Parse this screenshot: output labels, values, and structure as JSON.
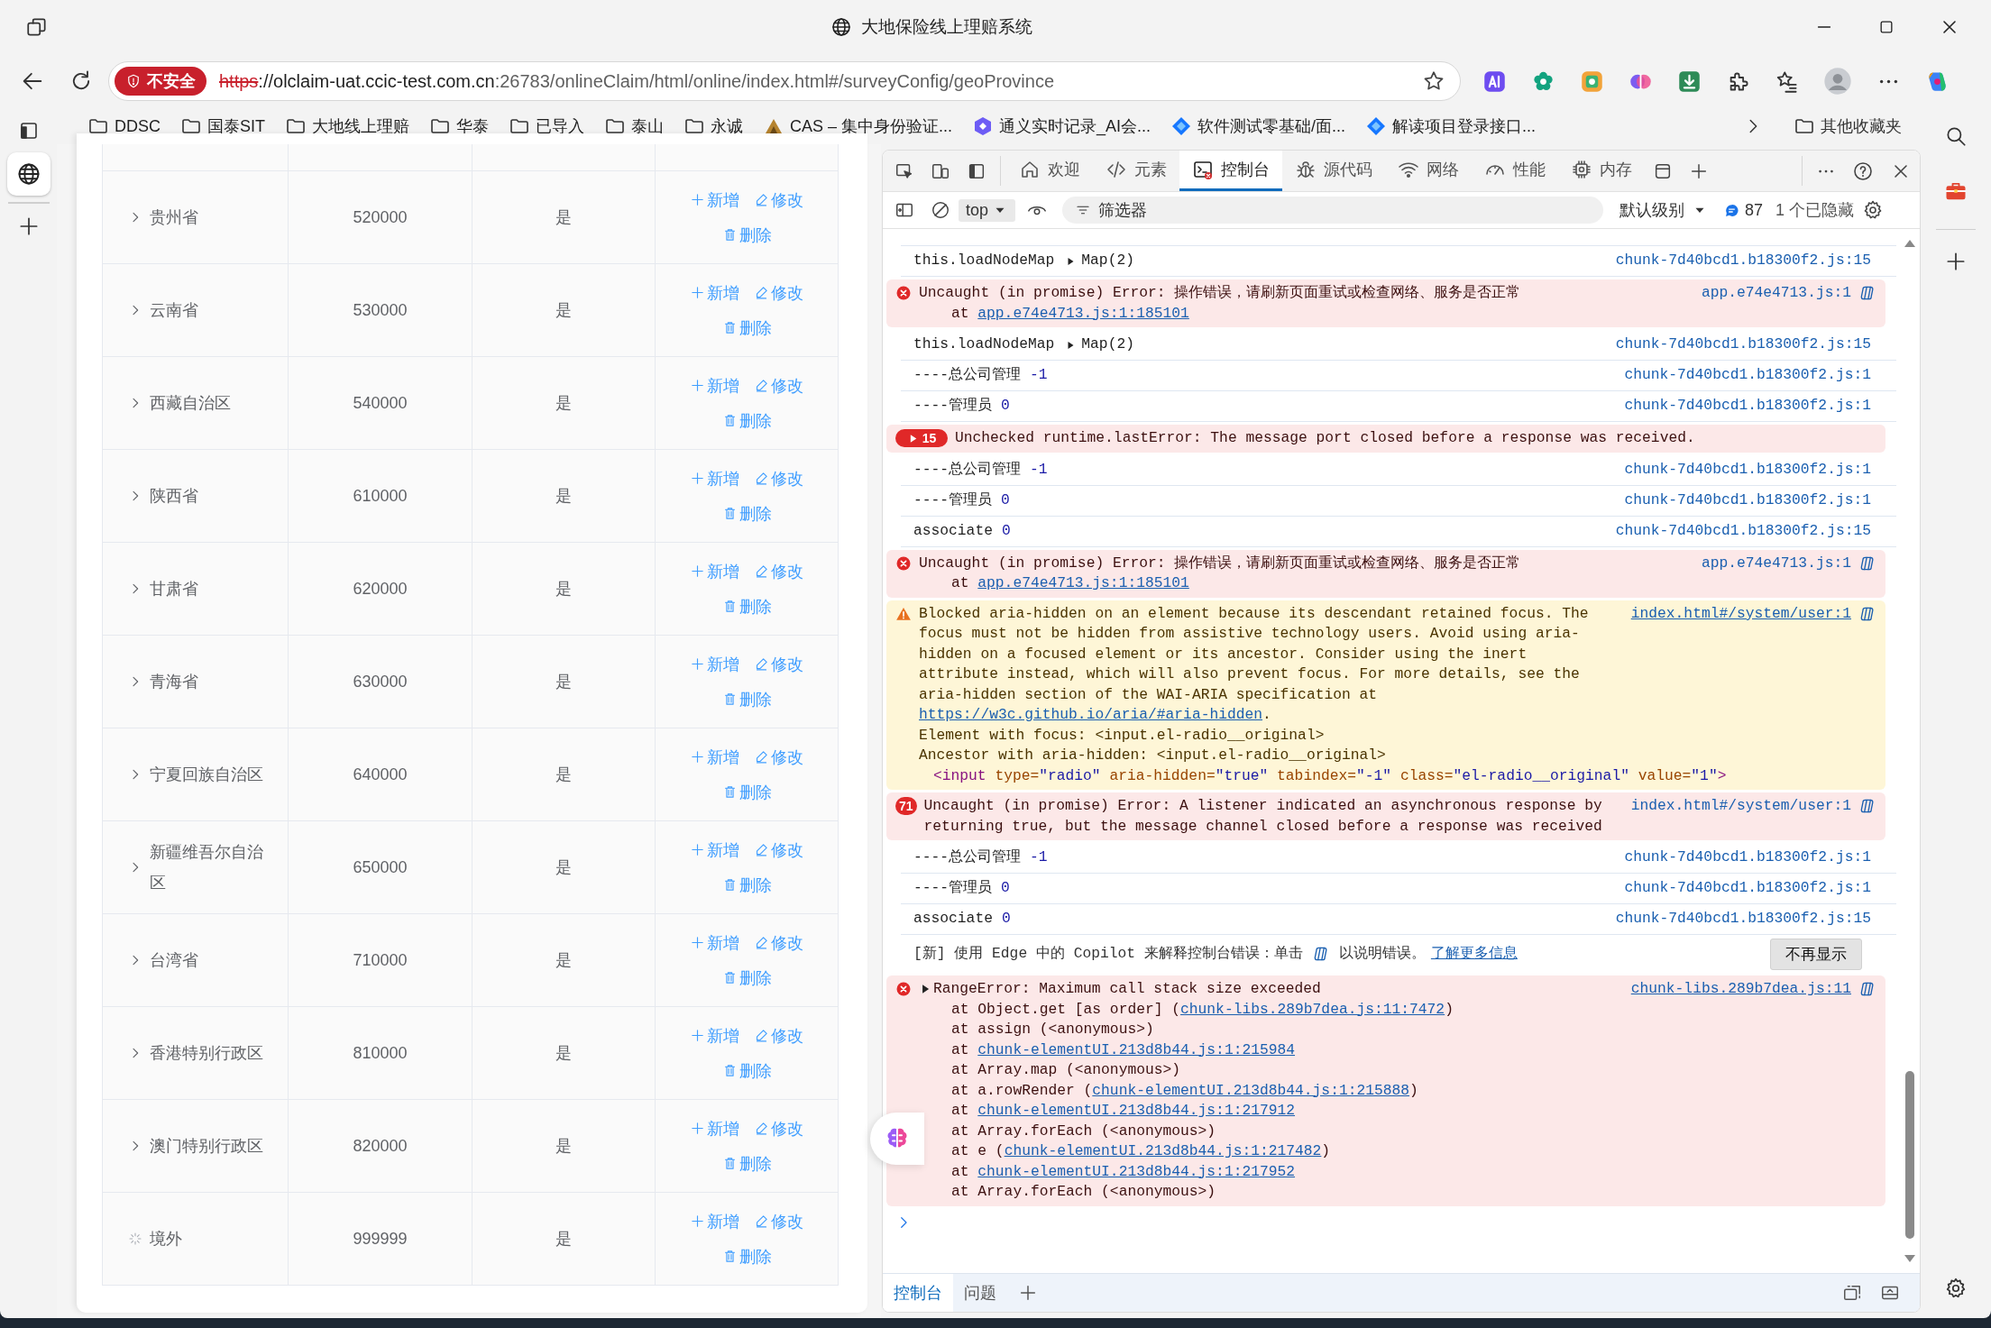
{
  "window": {
    "title": "大地保险线上理赔系统"
  },
  "address_bar": {
    "security_label": "不安全",
    "scheme": "https",
    "host": "://olclaim-uat.ccic-test.com.cn",
    "path": ":26783/onlineClaim/html/online/index.html#/surveyConfig/geoProvince"
  },
  "bookmarks": [
    {
      "kind": "folder",
      "label": "DDSC"
    },
    {
      "kind": "folder",
      "label": "国泰SIT"
    },
    {
      "kind": "folder",
      "label": "大地线上理赔"
    },
    {
      "kind": "folder",
      "label": "华泰"
    },
    {
      "kind": "folder",
      "label": "已导入"
    },
    {
      "kind": "folder",
      "label": "泰山"
    },
    {
      "kind": "folder",
      "label": "永诚"
    },
    {
      "kind": "cas",
      "label": "CAS – 集中身份验证..."
    },
    {
      "kind": "hexagon",
      "label": "通义实时记录_AI会..."
    },
    {
      "kind": "diamond",
      "label": "软件测试零基础/面..."
    },
    {
      "kind": "diamond",
      "label": "解读项目登录接口..."
    }
  ],
  "other_bookmarks": "其他收藏夹",
  "table": {
    "rows": [
      {
        "kind": "expandable",
        "name": "贵州省",
        "code": "520000",
        "flag": "是",
        "actions": [
          {
            "kind": "add",
            "label": "新增"
          },
          {
            "kind": "edit",
            "label": "修改"
          },
          {
            "kind": "delete",
            "label": "删除"
          }
        ]
      },
      {
        "kind": "expandable",
        "name": "云南省",
        "code": "530000",
        "flag": "是",
        "actions": [
          {
            "kind": "add",
            "label": "新增"
          },
          {
            "kind": "edit",
            "label": "修改"
          },
          {
            "kind": "delete",
            "label": "删除"
          }
        ]
      },
      {
        "kind": "expandable",
        "name": "西藏自治区",
        "code": "540000",
        "flag": "是",
        "actions": [
          {
            "kind": "add",
            "label": "新增"
          },
          {
            "kind": "edit",
            "label": "修改"
          },
          {
            "kind": "delete",
            "label": "删除"
          }
        ]
      },
      {
        "kind": "expandable",
        "name": "陕西省",
        "code": "610000",
        "flag": "是",
        "actions": [
          {
            "kind": "add",
            "label": "新增"
          },
          {
            "kind": "edit",
            "label": "修改"
          },
          {
            "kind": "delete",
            "label": "删除"
          }
        ]
      },
      {
        "kind": "expandable",
        "name": "甘肃省",
        "code": "620000",
        "flag": "是",
        "actions": [
          {
            "kind": "add",
            "label": "新增"
          },
          {
            "kind": "edit",
            "label": "修改"
          },
          {
            "kind": "delete",
            "label": "删除"
          }
        ]
      },
      {
        "kind": "expandable",
        "name": "青海省",
        "code": "630000",
        "flag": "是",
        "actions": [
          {
            "kind": "add",
            "label": "新增"
          },
          {
            "kind": "edit",
            "label": "修改"
          },
          {
            "kind": "delete",
            "label": "删除"
          }
        ]
      },
      {
        "kind": "expandable",
        "name": "宁夏回族自治区",
        "code": "640000",
        "flag": "是",
        "actions": [
          {
            "kind": "add",
            "label": "新增"
          },
          {
            "kind": "edit",
            "label": "修改"
          },
          {
            "kind": "delete",
            "label": "删除"
          }
        ]
      },
      {
        "kind": "expandable",
        "name": "新疆维吾尔自治区",
        "code": "650000",
        "flag": "是",
        "actions": [
          {
            "kind": "add",
            "label": "新增"
          },
          {
            "kind": "edit",
            "label": "修改"
          },
          {
            "kind": "delete",
            "label": "删除"
          }
        ]
      },
      {
        "kind": "expandable",
        "name": "台湾省",
        "code": "710000",
        "flag": "是",
        "actions": [
          {
            "kind": "add",
            "label": "新增"
          },
          {
            "kind": "edit",
            "label": "修改"
          },
          {
            "kind": "delete",
            "label": "删除"
          }
        ]
      },
      {
        "kind": "expandable",
        "name": "香港特别行政区",
        "code": "810000",
        "flag": "是",
        "actions": [
          {
            "kind": "add",
            "label": "新增"
          },
          {
            "kind": "edit",
            "label": "修改"
          },
          {
            "kind": "delete",
            "label": "删除"
          }
        ]
      },
      {
        "kind": "expandable",
        "name": "澳门特别行政区",
        "code": "820000",
        "flag": "是",
        "actions": [
          {
            "kind": "add",
            "label": "新增"
          },
          {
            "kind": "edit",
            "label": "修改"
          },
          {
            "kind": "delete",
            "label": "删除"
          }
        ]
      },
      {
        "kind": "loading",
        "name": "境外",
        "code": "999999",
        "flag": "是",
        "actions": [
          {
            "kind": "add",
            "label": "新增"
          },
          {
            "kind": "edit",
            "label": "修改"
          },
          {
            "kind": "delete",
            "label": "删除"
          }
        ]
      }
    ]
  },
  "devtools": {
    "tabs": [
      {
        "kind": "home",
        "label": "欢迎",
        "selected": false
      },
      {
        "kind": "code",
        "label": "元素",
        "selected": false
      },
      {
        "kind": "console",
        "label": "控制台",
        "selected": true
      },
      {
        "kind": "bug",
        "label": "源代码",
        "selected": false
      },
      {
        "kind": "wifi",
        "label": "网络",
        "selected": false
      },
      {
        "kind": "gauge",
        "label": "性能",
        "selected": false
      },
      {
        "kind": "chip",
        "label": "内存",
        "selected": false
      }
    ],
    "toolbar": {
      "context": "top",
      "filter_placeholder": "筛选器",
      "level": "默认级别",
      "message_count": "87",
      "hidden": "1 个已隐藏"
    },
    "messages": [
      {
        "kind": "log",
        "text": "this.loadNodeMap",
        "value": "Map(2)",
        "expandable": true,
        "source": "chunk-7d40bcd1.b18300f2.js:15"
      },
      {
        "kind": "error",
        "text": "Uncaught (in promise) Error: 操作错误，请刷新页面重试或检查网络、服务是否正常",
        "stack": [
          {
            "before": "at ",
            "link": "app.e74e4713.js:1:185101"
          }
        ],
        "source": "app.e74e4713.js:1",
        "explain": true
      },
      {
        "kind": "log",
        "text": "this.loadNodeMap",
        "value": "Map(2)",
        "expandable": true,
        "source": "chunk-7d40bcd1.b18300f2.js:15"
      },
      {
        "kind": "log",
        "text": "----总公司管理",
        "value": "-1",
        "expandable": false,
        "source": "chunk-7d40bcd1.b18300f2.js:1"
      },
      {
        "kind": "log",
        "text": "----管理员",
        "value": "0",
        "expandable": false,
        "source": "chunk-7d40bcd1.b18300f2.js:1"
      },
      {
        "kind": "error",
        "count": "15",
        "expandable": true,
        "text": "Unchecked runtime.lastError: The message port closed before a response was received."
      },
      {
        "kind": "log",
        "text": "----总公司管理",
        "value": "-1",
        "expandable": false,
        "source": "chunk-7d40bcd1.b18300f2.js:1"
      },
      {
        "kind": "log",
        "text": "----管理员",
        "value": "0",
        "expandable": false,
        "source": "chunk-7d40bcd1.b18300f2.js:1"
      },
      {
        "kind": "log",
        "text": "associate",
        "value": "0",
        "expandable": false,
        "source": "chunk-7d40bcd1.b18300f2.js:15"
      },
      {
        "kind": "error",
        "text": "Uncaught (in promise) Error: 操作错误，请刷新页面重试或检查网络、服务是否正常",
        "stack": [
          {
            "before": "at ",
            "link": "app.e74e4713.js:1:185101"
          }
        ],
        "source": "app.e74e4713.js:1",
        "explain": true
      },
      {
        "kind": "warning",
        "text": "Blocked aria-hidden on an element because its descendant retained focus. The focus must not be hidden from assistive technology users. Avoid using aria-hidden on a focused element or its ancestor. Consider using the inert attribute instead, which will also prevent focus. For more details, see the aria-hidden section of the WAI-ARIA specification at ",
        "link": "https://w3c.github.io/aria/#aria-hidden",
        "after": ".",
        "details": [
          "Element with focus: <input.el-radio__original>",
          "Ancestor with aria-hidden: <input.el-radio__original>"
        ],
        "node": [
          {
            "kind": "tag",
            "text": "<input"
          },
          {
            "kind": "attr",
            "text": " type="
          },
          {
            "kind": "value",
            "text": "\"radio\""
          },
          {
            "kind": "attr",
            "text": " aria-hidden="
          },
          {
            "kind": "value",
            "text": "\"true\""
          },
          {
            "kind": "attr",
            "text": " tabindex="
          },
          {
            "kind": "value",
            "text": "\"-1\""
          },
          {
            "kind": "attr",
            "text": " class="
          },
          {
            "kind": "value",
            "text": "\"el-radio__original\""
          },
          {
            "kind": "attr",
            "text": " value="
          },
          {
            "kind": "value",
            "text": "\"1\""
          },
          {
            "kind": "tag",
            "text": ">"
          }
        ],
        "source": "index.html#/system/user:1",
        "source_underlined": true,
        "explain": true
      },
      {
        "kind": "error",
        "count": "71",
        "expandable": false,
        "text": "Uncaught (in promise) Error: A listener indicated an asynchronous response by returning true, but the message channel closed before a response was received",
        "source": "index.html#/system/user:1",
        "explain": true
      },
      {
        "kind": "log",
        "text": "----总公司管理",
        "value": "-1",
        "expandable": false,
        "source": "chunk-7d40bcd1.b18300f2.js:1"
      },
      {
        "kind": "log",
        "text": "----管理员",
        "value": "0",
        "expandable": false,
        "source": "chunk-7d40bcd1.b18300f2.js:1"
      },
      {
        "kind": "log",
        "text": "associate",
        "value": "0",
        "expandable": false,
        "source": "chunk-7d40bcd1.b18300f2.js:15"
      },
      {
        "kind": "tip",
        "text": "[新] 使用 Edge 中的 Copilot 来解释控制台错误：单击",
        "after_icon": "以说明错误。",
        "link": "了解更多信息",
        "button": "不再显示"
      },
      {
        "kind": "error",
        "expandable": true,
        "text": "RangeError: Maximum call stack size exceeded",
        "source": "chunk-libs.289b7dea.js:11",
        "source_underlined": true,
        "explain": true,
        "stack": [
          {
            "before": "at Object.get [as order] (",
            "link": "chunk-libs.289b7dea.js:11:7472",
            "after": ")"
          },
          {
            "before": "at assign (<anonymous>)"
          },
          {
            "before": "at ",
            "link": "chunk-elementUI.213d8b44.js:1:215984"
          },
          {
            "before": "at Array.map (<anonymous>)"
          },
          {
            "before": "at a.rowRender (",
            "link": "chunk-elementUI.213d8b44.js:1:215888",
            "after": ")"
          },
          {
            "before": "at ",
            "link": "chunk-elementUI.213d8b44.js:1:217912"
          },
          {
            "before": "at Array.forEach (<anonymous>)"
          },
          {
            "before": "at e (",
            "link": "chunk-elementUI.213d8b44.js:1:217482",
            "after": ")"
          },
          {
            "before": "at ",
            "link": "chunk-elementUI.213d8b44.js:1:217952"
          },
          {
            "before": "at Array.forEach (<anonymous>)"
          }
        ]
      }
    ],
    "drawer_tabs": [
      {
        "label": "控制台",
        "selected": true
      },
      {
        "label": "问题",
        "selected": false
      }
    ]
  }
}
